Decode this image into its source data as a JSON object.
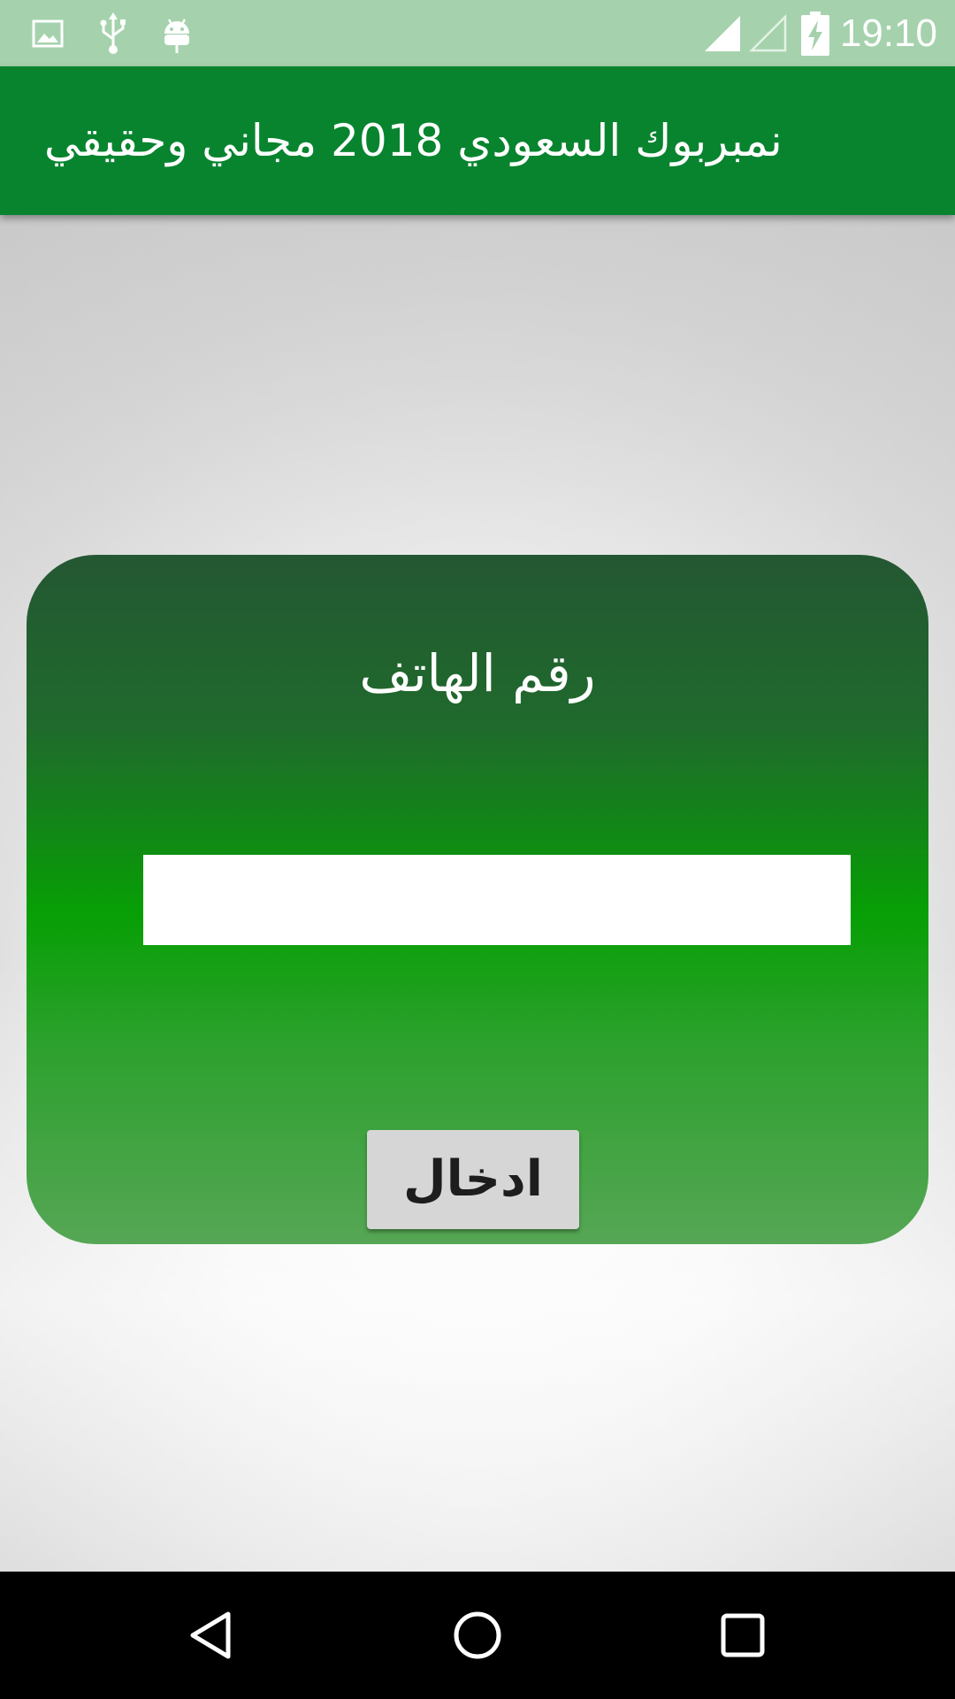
{
  "status_bar": {
    "time": "19:10",
    "icons": [
      "image-icon",
      "usb-icon",
      "android-icon",
      "signal-icon",
      "signal-empty-icon",
      "battery-charging-icon"
    ]
  },
  "app_bar": {
    "title": "نمبربوك السعودي 2018 مجاني وحقيقي"
  },
  "card": {
    "label": "رقم الهاتف",
    "input": {
      "value": "",
      "placeholder": ""
    },
    "button_label": "ادخال"
  },
  "nav_bar": {
    "icons": [
      "back-icon",
      "home-icon",
      "recents-icon"
    ]
  },
  "colors": {
    "status_bar": "#a5d2ac",
    "app_bar": "#08842f",
    "card_top": "#245733",
    "card_middle": "#079f05",
    "card_bottom": "#56a655",
    "button": "#d6d6d6"
  }
}
